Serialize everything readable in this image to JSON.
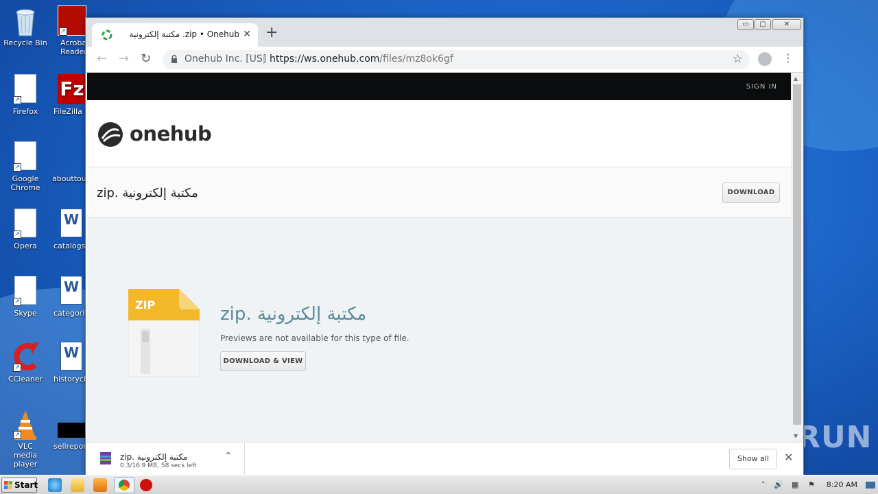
{
  "desktop": {
    "icons": [
      {
        "label": "Recycle Bin",
        "icon": "recycle-bin-icon"
      },
      {
        "label": "Acrobat Reader",
        "icon": "acrobat-icon"
      },
      {
        "label": "Firefox",
        "icon": "firefox-icon"
      },
      {
        "label": "FileZilla C",
        "icon": "filezilla-icon"
      },
      {
        "label": "Google Chrome",
        "icon": "chrome-icon"
      },
      {
        "label": "abouttour",
        "icon": "blank-file-icon"
      },
      {
        "label": "Opera",
        "icon": "opera-icon"
      },
      {
        "label": "catalogsc",
        "icon": "word-doc-icon"
      },
      {
        "label": "Skype",
        "icon": "skype-icon"
      },
      {
        "label": "categorie",
        "icon": "word-doc-icon"
      },
      {
        "label": "CCleaner",
        "icon": "ccleaner-icon"
      },
      {
        "label": "historyclo",
        "icon": "word-doc-icon"
      },
      {
        "label": "VLC media player",
        "icon": "vlc-icon"
      },
      {
        "label": "sellreport",
        "icon": "black-file-icon"
      }
    ]
  },
  "browser": {
    "tab_title": "zip • Onehub. مكتبة إلكترونية",
    "new_tab_symbol": "+",
    "tab_close_symbol": "✕",
    "window_buttons": {
      "minimize": "▭",
      "maximize": "▢",
      "close": "✕"
    },
    "nav": {
      "back": "←",
      "forward": "→",
      "reload": "↻"
    },
    "omnibox": {
      "org": "Onehub Inc. [US]",
      "separator": "|",
      "host": "https://ws.onehub.com",
      "path": "/files/mz8ok6gf"
    },
    "star_symbol": "☆",
    "menu_symbol": "⋮"
  },
  "page": {
    "sign_in": "SIGN IN",
    "logo_text": "onehub",
    "filename": "مكتبة إلكترونية .zip",
    "download_button": "DOWNLOAD",
    "zip_badge": "ZIP",
    "preview_filename": "مكتبة إلكترونية .zip",
    "preview_message": "Previews are not available for this type of file.",
    "download_view_button": "DOWNLOAD & VIEW"
  },
  "shelf": {
    "file_name": "مكتبة إلكترونية .zip",
    "status": "0.3/16.9 MB, 58 secs left",
    "chevron": "⌃",
    "show_all": "Show all",
    "close": "✕"
  },
  "watermark": "ANY RUN",
  "taskbar": {
    "start": "Start",
    "clock": "8:20 AM"
  },
  "colors": {
    "accent_teal": "#5b8a9c",
    "topbar_black": "#0b0c0d",
    "zip_yellow": "#f2b82a"
  }
}
